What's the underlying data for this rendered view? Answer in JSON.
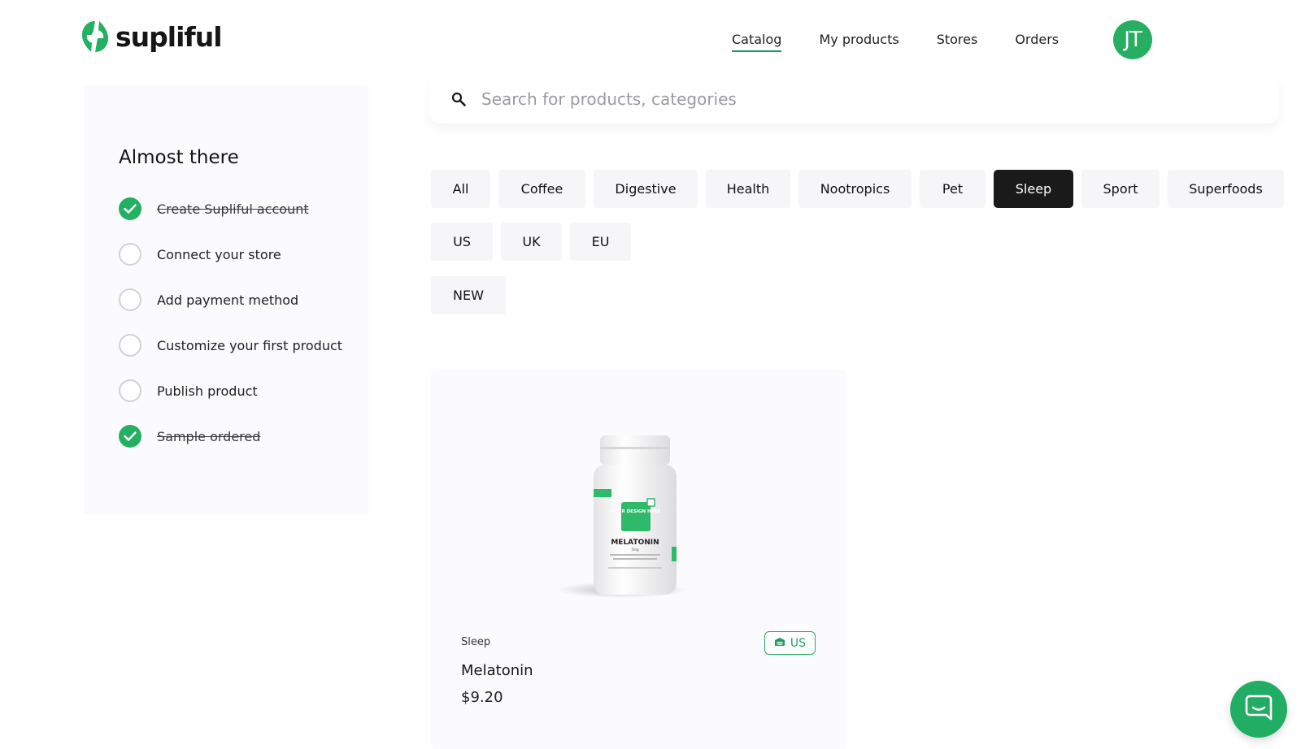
{
  "brand": {
    "name": "supliful",
    "accent_color": "#23b063"
  },
  "nav": {
    "items": [
      {
        "label": "Catalog",
        "active": true
      },
      {
        "label": "My products",
        "active": false
      },
      {
        "label": "Stores",
        "active": false
      },
      {
        "label": "Orders",
        "active": false
      }
    ],
    "avatar_initials": "JT"
  },
  "sidebar": {
    "title": "Almost there",
    "steps": [
      {
        "label": "Create Supliful account",
        "done": true
      },
      {
        "label": "Connect your store",
        "done": false
      },
      {
        "label": "Add payment method",
        "done": false
      },
      {
        "label": "Customize your first product",
        "done": false
      },
      {
        "label": "Publish product",
        "done": false
      },
      {
        "label": "Sample ordered",
        "done": true
      }
    ]
  },
  "search": {
    "placeholder": "Search for products, categories",
    "value": ""
  },
  "filters": {
    "categories": [
      {
        "label": "All",
        "active": false
      },
      {
        "label": "Coffee",
        "active": false
      },
      {
        "label": "Digestive",
        "active": false
      },
      {
        "label": "Health",
        "active": false
      },
      {
        "label": "Nootropics",
        "active": false
      },
      {
        "label": "Pet",
        "active": false
      },
      {
        "label": "Sleep",
        "active": true
      },
      {
        "label": "Sport",
        "active": false
      },
      {
        "label": "Superfoods",
        "active": false
      }
    ],
    "regions": [
      {
        "label": "US"
      },
      {
        "label": "UK"
      },
      {
        "label": "EU"
      }
    ],
    "tags": [
      {
        "label": "NEW"
      }
    ]
  },
  "products": [
    {
      "category": "Sleep",
      "name": "Melatonin",
      "price": "$9.20",
      "region": "US",
      "image": {
        "label_top": "YOUR DESIGN HERE",
        "label_name": "MELATONIN",
        "label_dose": "5mg"
      }
    }
  ],
  "chat": {
    "icon": "chat-icon"
  }
}
